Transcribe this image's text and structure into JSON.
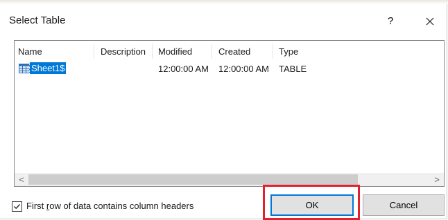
{
  "dialog": {
    "title": "Select Table",
    "help_label": "?",
    "close_icon": "close-icon"
  },
  "table": {
    "columns": [
      "Name",
      "Description",
      "Modified",
      "Created",
      "Type"
    ],
    "rows": [
      {
        "name": "Sheet1$",
        "description": "",
        "modified": "12:00:00 AM",
        "created": "12:00:00 AM",
        "type": "TABLE",
        "icon": "table-icon",
        "selected": true
      }
    ]
  },
  "scrollbar": {
    "left_arrow": "<",
    "right_arrow": ">"
  },
  "options": {
    "header_checkbox_checked": true,
    "header_checkbox_label": "First row of data contains column headers"
  },
  "buttons": {
    "ok_label": "OK",
    "cancel_label": "Cancel"
  },
  "colors": {
    "selection": "#0078d7",
    "highlight_box": "#e3202c"
  }
}
